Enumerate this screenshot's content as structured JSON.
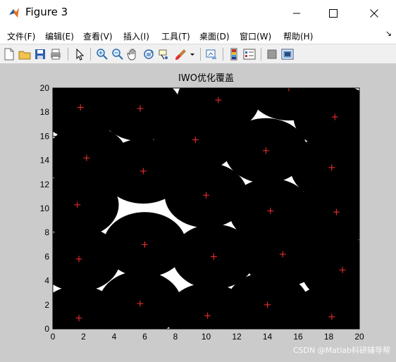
{
  "window": {
    "title": "Figure 3",
    "icon": "matlab-icon",
    "controls": [
      "minimize-icon",
      "maximize-icon",
      "close-icon"
    ]
  },
  "menu": {
    "items": [
      "文件(F)",
      "编辑(E)",
      "查看(V)",
      "插入(I)",
      "工具(T)",
      "桌面(D)",
      "窗口(W)",
      "帮助(H)"
    ],
    "overflow_icon": "chevron-icon"
  },
  "toolbar": {
    "icons": [
      "new-figure-icon",
      "open-file-icon",
      "save-icon",
      "print-icon",
      "pointer-icon",
      "zoom-in-icon",
      "zoom-out-icon",
      "pan-icon",
      "rotate-3d-icon",
      "data-cursor-icon",
      "brush-icon",
      "link-plot-icon",
      "colorbar-icon",
      "legend-icon",
      "hide-plot-tools-icon",
      "show-plot-tools-icon"
    ]
  },
  "plot": {
    "title": "IWO优化覆盖"
  },
  "watermark": "CSDN @Matlab科研辅导帮",
  "chart_data": {
    "type": "scatter",
    "title": "IWO优化覆盖",
    "xlim": [
      0,
      20
    ],
    "ylim": [
      0,
      20
    ],
    "xticks": [
      "0",
      "2",
      "4",
      "6",
      "8",
      "10",
      "12",
      "14",
      "16",
      "18",
      "20"
    ],
    "yticks": [
      "0",
      "2",
      "4",
      "6",
      "8",
      "10",
      "12",
      "14",
      "16",
      "18",
      "20"
    ],
    "sensing_radius": 2.7,
    "marker": "+",
    "colors": {
      "coverage": "#000000",
      "uncovered": "#ffffff",
      "marker": "#ff3030",
      "figure_bg": "#cbcbcb"
    },
    "points": [
      [
        2.2,
        14.2
      ],
      [
        1.6,
        10.3
      ],
      [
        1.7,
        5.8
      ],
      [
        1.7,
        0.9
      ],
      [
        1.8,
        18.4
      ],
      [
        5.7,
        18.3
      ],
      [
        5.9,
        13.1
      ],
      [
        6.0,
        7.0
      ],
      [
        5.7,
        2.1
      ],
      [
        9.3,
        15.7
      ],
      [
        10.8,
        19.0
      ],
      [
        10.0,
        11.1
      ],
      [
        10.5,
        6.0
      ],
      [
        10.1,
        1.1
      ],
      [
        14.0,
        2.0
      ],
      [
        15.0,
        6.2
      ],
      [
        14.2,
        9.8
      ],
      [
        13.9,
        14.8
      ],
      [
        15.4,
        20.0
      ],
      [
        18.2,
        1.0
      ],
      [
        18.9,
        4.9
      ],
      [
        18.5,
        9.7
      ],
      [
        18.2,
        13.4
      ],
      [
        18.4,
        17.6
      ]
    ]
  }
}
